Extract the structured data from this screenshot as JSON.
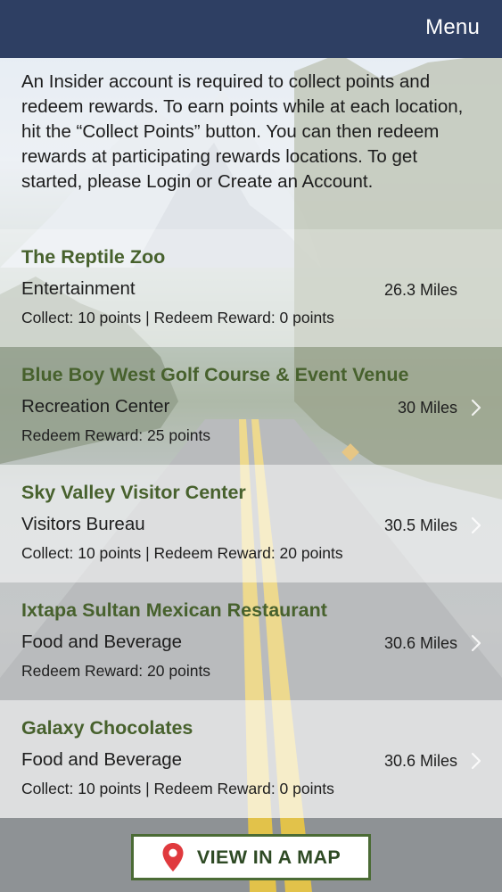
{
  "header": {
    "menu_label": "Menu",
    "bg_color": "#2e3f63"
  },
  "intro": {
    "text": "An Insider account is required to collect points and redeem rewards. To earn points while at each location, hit the “Collect Points” button. You can then redeem rewards at participating rewards locations. To get started, please Login or Create an Account."
  },
  "locations": [
    {
      "name": "The Reptile Zoo",
      "category": "Entertainment",
      "distance": "26.3 Miles",
      "points": "Collect: 10 points  |  Redeem Reward: 0 points"
    },
    {
      "name": "Blue Boy West Golf Course & Event Venue",
      "category": "Recreation Center",
      "distance": "30 Miles",
      "points": "Redeem Reward: 25 points"
    },
    {
      "name": "Sky Valley Visitor Center",
      "category": "Visitors Bureau",
      "distance": "30.5 Miles",
      "points": "Collect: 10 points  |  Redeem Reward: 20 points"
    },
    {
      "name": "Ixtapa Sultan Mexican Restaurant",
      "category": "Food and Beverage",
      "distance": "30.6 Miles",
      "points": "Redeem Reward: 20 points"
    },
    {
      "name": "Galaxy Chocolates",
      "category": "Food and Beverage",
      "distance": "30.6 Miles",
      "points": "Collect: 10 points  |  Redeem Reward: 0 points"
    }
  ],
  "map_button": {
    "label": "VIEW IN A MAP",
    "icon": "map-pin-icon"
  },
  "colors": {
    "title_green": "#47612d",
    "button_border": "#4b6b35",
    "pin_red": "#e03a3e"
  }
}
